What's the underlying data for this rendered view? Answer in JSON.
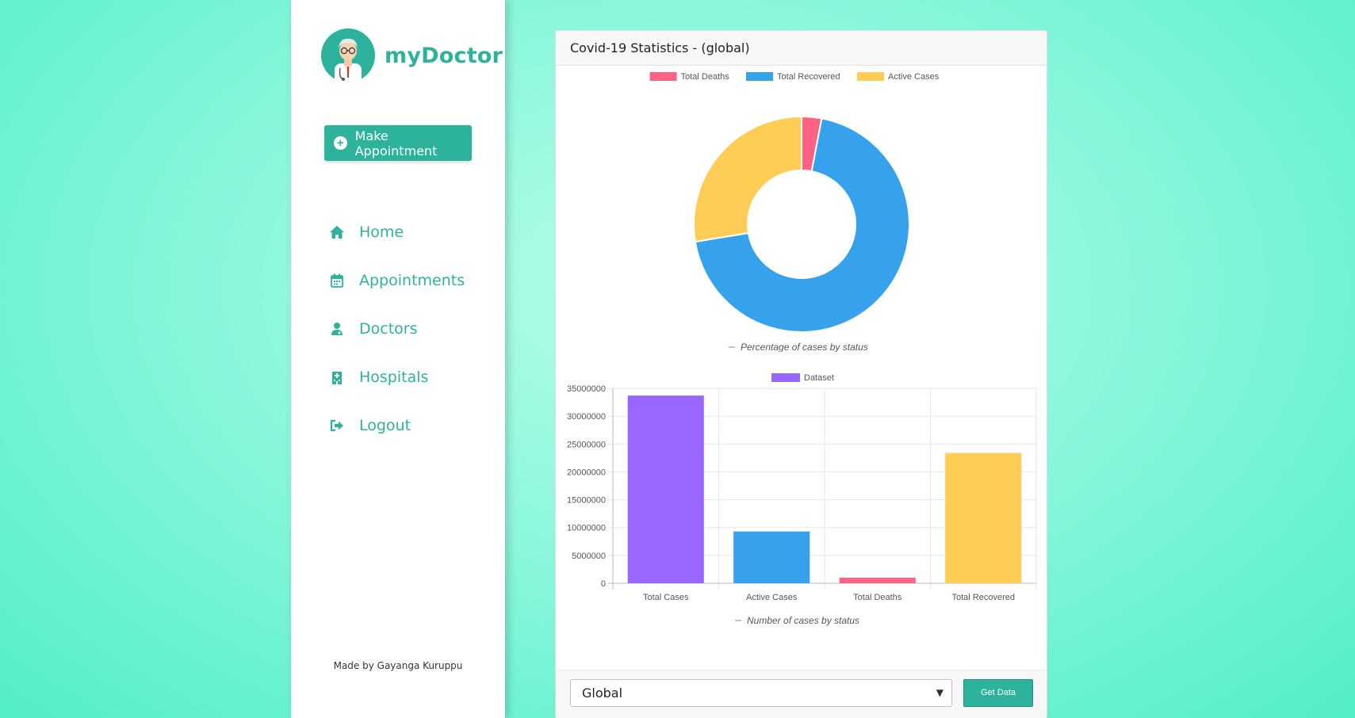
{
  "sidebar": {
    "brand": "myDoctor",
    "make_appointment": "Make Appointment",
    "nav": [
      {
        "label": "Home",
        "icon": "home-icon"
      },
      {
        "label": "Appointments",
        "icon": "calendar-icon"
      },
      {
        "label": "Doctors",
        "icon": "doctor-icon"
      },
      {
        "label": "Hospitals",
        "icon": "hospital-icon"
      },
      {
        "label": "Logout",
        "icon": "logout-icon"
      }
    ],
    "footer": "Made by Gayanga Kuruppu"
  },
  "card": {
    "title": "Covid-19 Statistics - (global)",
    "select_value": "Global",
    "get_data": "Get Data"
  },
  "colors": {
    "accent": "#2db39c",
    "deaths": "#ff6384",
    "recovered": "#36a2eb",
    "active": "#ffcd56",
    "dataset": "#9966ff"
  },
  "chart_data": [
    {
      "type": "pie",
      "variant": "doughnut",
      "legend": [
        "Total Deaths",
        "Total Recovered",
        "Active Cases"
      ],
      "legend_position": "top",
      "values": [
        1008000,
        23400000,
        9300000
      ],
      "colors": [
        "#ff6384",
        "#36a2eb",
        "#ffcd56"
      ],
      "title": "Percentage of cases by status"
    },
    {
      "type": "bar",
      "legend": [
        "Dataset"
      ],
      "legend_position": "top",
      "categories": [
        "Total Cases",
        "Active Cases",
        "Total Deaths",
        "Total Recovered"
      ],
      "values": [
        33700000,
        9300000,
        1008000,
        23400000
      ],
      "colors": [
        "#9966ff",
        "#36a2eb",
        "#ff6384",
        "#ffcd56"
      ],
      "ylim": [
        0,
        35000000
      ],
      "yticks": [
        "35000000",
        "30000000",
        "25000000",
        "20000000",
        "15000000",
        "10000000",
        "5000000",
        "0"
      ],
      "grid": true,
      "title": "Number of cases by status"
    }
  ]
}
